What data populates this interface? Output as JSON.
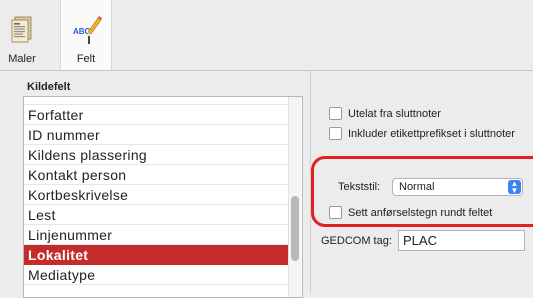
{
  "toolbar": {
    "items": [
      {
        "label": "Maler",
        "icon": "templates-icon"
      },
      {
        "label": "Felt",
        "icon": "abc-pencil-icon"
      }
    ]
  },
  "left_panel": {
    "title": "Kildefelt",
    "list": [
      "Forfatter",
      "ID nummer",
      "Kildens plassering",
      "Kontakt person",
      "Kortbeskrivelse",
      "Lest",
      "Linjenummer",
      "Lokalitet",
      "Mediatype"
    ],
    "selected": "Lokalitet"
  },
  "right_panel": {
    "omit_endnotes": "Utelat fra sluttnoter",
    "include_label_prefix": "Inkluder etikettprefikset i sluttnoter",
    "text_style_label": "Tekststil:",
    "text_style_value": "Normal",
    "quote_field": "Sett anførselstegn rundt feltet",
    "gedcom_label": "GEDCOM tag:",
    "gedcom_value": "PLAC"
  },
  "colors": {
    "selection": "#c42b2b",
    "highlight_outline": "#e12020",
    "select_stepper": "#3a82f7"
  }
}
